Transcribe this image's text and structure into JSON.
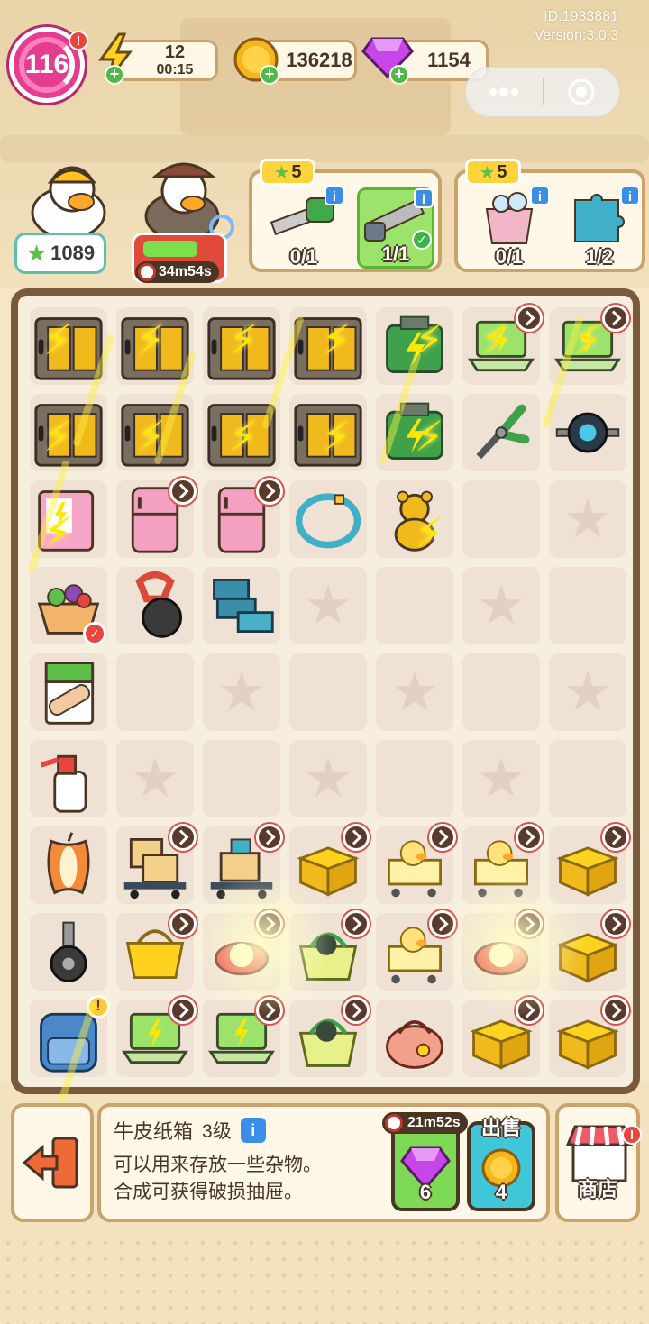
{
  "hud": {
    "level": "116",
    "energy": "12",
    "energy_timer": "00:15",
    "coins": "136218",
    "gems": "1154",
    "id_text": "ID:1933881",
    "version_text": "Version:3.0.3"
  },
  "characters": {
    "star_count": "1089",
    "detective_timer": "34m54s"
  },
  "orders": [
    {
      "stars": "5",
      "items": [
        {
          "name": "saw-tool",
          "qty": "0/1",
          "done": false
        },
        {
          "name": "chainsaw-blade",
          "qty": "1/1",
          "done": true
        }
      ]
    },
    {
      "stars": "5",
      "items": [
        {
          "name": "soap-bucket",
          "qty": "0/1",
          "done": false
        },
        {
          "name": "blue-puzzle",
          "qty": "1/2",
          "done": false
        }
      ]
    }
  ],
  "board": {
    "rows": [
      [
        "locker",
        "locker",
        "locker",
        "locker",
        "green-toolbox",
        "laptop-lock",
        "laptop-lock"
      ],
      [
        "locker",
        "locker",
        "locker",
        "locker",
        "green-toolbox",
        "pliers",
        "ab-roller"
      ],
      [
        "pink-vending",
        "pink-fridge-lock",
        "pink-fridge-lock",
        "blue-hoop",
        "teddy-bear",
        "empty",
        "star"
      ],
      [
        "salad-ok",
        "kettlebell",
        "blue-stack",
        "star",
        "empty",
        "star",
        "empty"
      ],
      [
        "bandage",
        "empty",
        "star",
        "empty",
        "star",
        "empty",
        "star"
      ],
      [
        "spray-bottle",
        "star",
        "empty",
        "star",
        "empty",
        "star",
        "empty"
      ],
      [
        "apple-core",
        "boxes-cart-lock",
        "cart-lock",
        "gold-box-lock",
        "duck-cart-lock",
        "duck-cart-lock",
        "gold-box-lock"
      ],
      [
        "caster-wheel",
        "yellow-basket-lock",
        "red-item-lock",
        "green-basket-lock",
        "duck-cart-lock",
        "red-item-lock",
        "gold-box-lock"
      ],
      [
        "backpack-alert",
        "laptop-lock",
        "laptop-lock",
        "green-basket-lock",
        "pink-bag",
        "gold-box-lock",
        "gold-box-lock"
      ]
    ]
  },
  "info": {
    "item_name": "牛皮纸箱",
    "item_level": "3级",
    "desc_line1": "可以用来存放一些杂物。",
    "desc_line2": "合成可获得破损抽屉。",
    "speed_timer": "21m52s",
    "gem_cost": "6",
    "sell_label": "出售",
    "sell_value": "4"
  },
  "shop": {
    "label": "商店"
  },
  "colors": {
    "brand_pink": "#e43d8f",
    "board_border": "#7a5a3c",
    "panel_border": "#c9a26c",
    "sell_blue": "#3fc6d8",
    "speed_green": "#7ed957"
  }
}
